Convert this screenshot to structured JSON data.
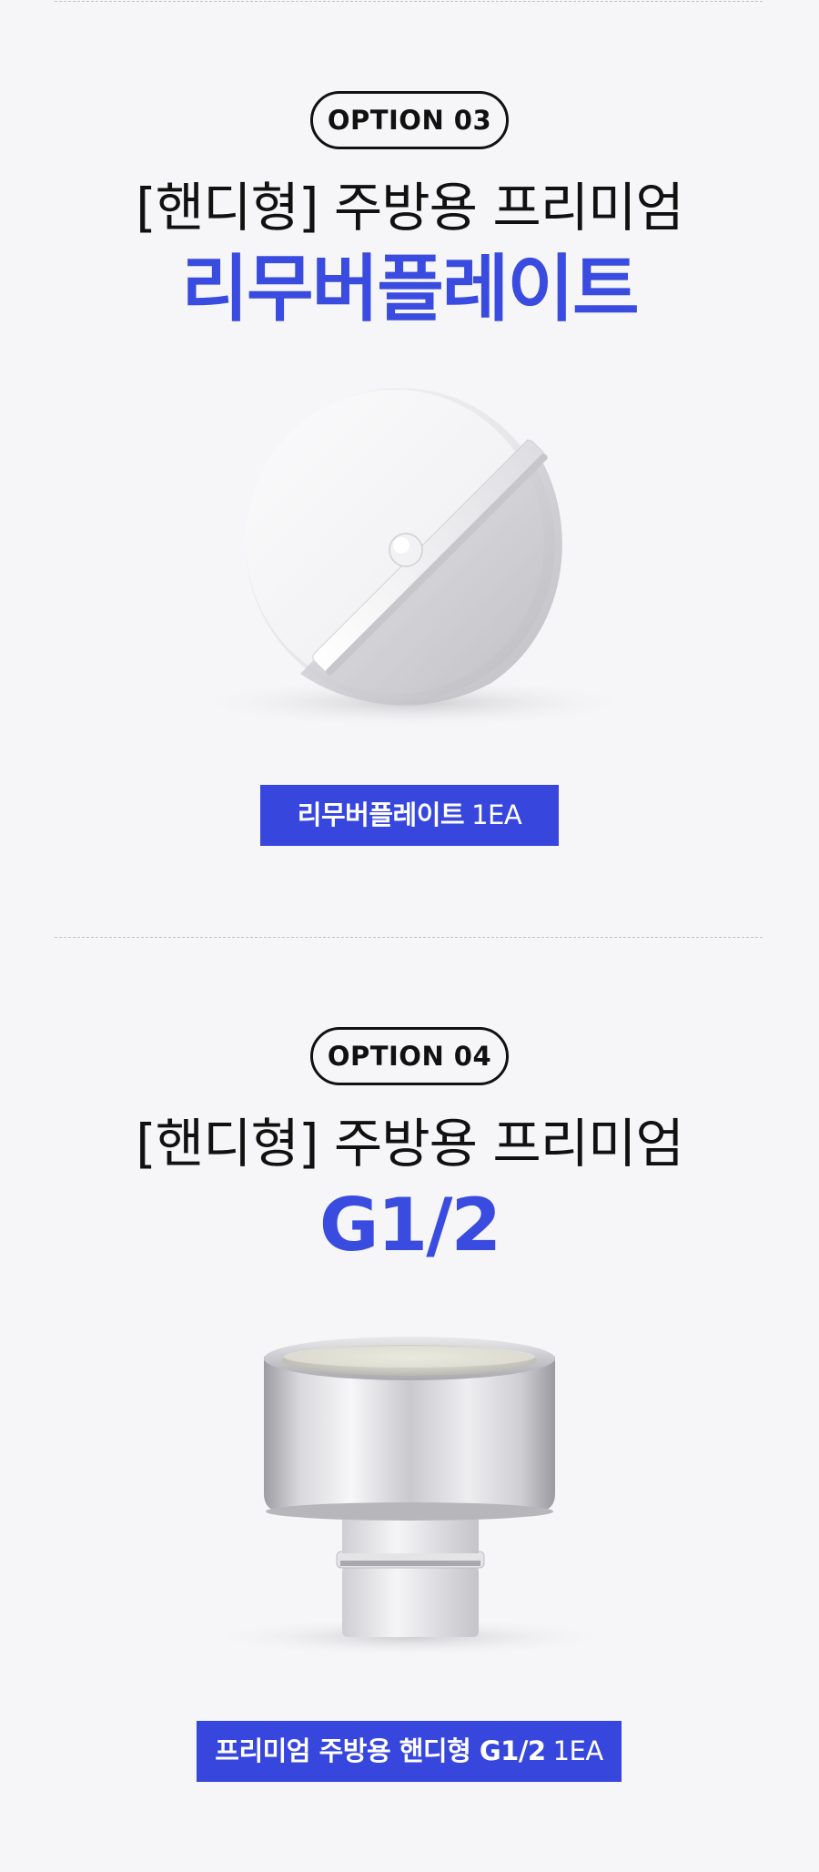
{
  "option3": {
    "badge": "OPTION 03",
    "title": "[핸디형] 주방용 프리미엄",
    "subtitle": "리무버플레이트",
    "tag_strong": "리무버플레이트",
    "tag_light": "1EA"
  },
  "option4": {
    "badge": "OPTION 04",
    "title": "[핸디형] 주방용 프리미엄",
    "subtitle": "G1/2",
    "tag_strong": "프리미엄 주방용 핸디형 G1/2",
    "tag_light": "1EA"
  },
  "colors": {
    "accent": "#3a4be0",
    "tag_bg": "#3746dd",
    "background": "#f6f6f8"
  }
}
